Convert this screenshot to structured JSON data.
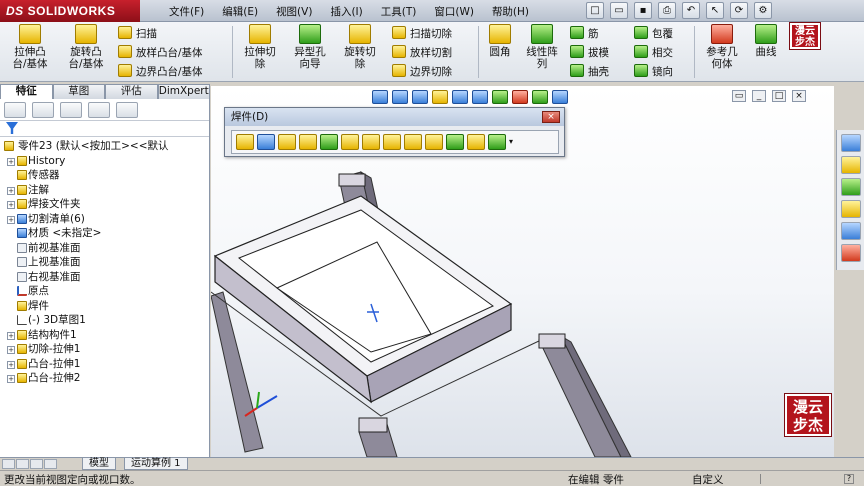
{
  "app": {
    "brand": "SOLIDWORKS",
    "brand_prefix": "DS"
  },
  "menu": [
    "文件(F)",
    "编辑(E)",
    "视图(V)",
    "插入(I)",
    "工具(T)",
    "窗口(W)",
    "帮助(H)"
  ],
  "commands": {
    "big": [
      {
        "label": "拉伸凸\n台/基体",
        "icon": "extrude-boss-icon"
      },
      {
        "label": "旋转凸\n台/基体",
        "icon": "revolve-boss-icon"
      },
      {
        "label": "拉伸切\n除",
        "icon": "extrude-cut-icon"
      },
      {
        "label": "异型孔\n向导",
        "icon": "hole-wizard-icon"
      },
      {
        "label": "旋转切\n除",
        "icon": "revolve-cut-icon"
      },
      {
        "label": "圆角",
        "icon": "fillet-icon"
      },
      {
        "label": "线性阵\n列",
        "icon": "linear-pattern-icon"
      },
      {
        "label": "参考几\n何体",
        "icon": "reference-geometry-icon"
      },
      {
        "label": "曲线",
        "icon": "curves-icon"
      }
    ],
    "small": [
      {
        "label": "扫描",
        "icon": "sweep-icon"
      },
      {
        "label": "放样凸台/基体",
        "icon": "loft-icon"
      },
      {
        "label": "边界凸台/基体",
        "icon": "boundary-boss-icon"
      },
      {
        "label": "扫描切除",
        "icon": "swept-cut-icon"
      },
      {
        "label": "放样切割",
        "icon": "lofted-cut-icon"
      },
      {
        "label": "边界切除",
        "icon": "boundary-cut-icon"
      },
      {
        "label": "筋",
        "icon": "rib-icon"
      },
      {
        "label": "拔模",
        "icon": "draft-icon"
      },
      {
        "label": "抽壳",
        "icon": "shell-icon"
      },
      {
        "label": "包覆",
        "icon": "wrap-icon"
      },
      {
        "label": "相交",
        "icon": "intersect-icon"
      },
      {
        "label": "镜向",
        "icon": "mirror-icon"
      }
    ]
  },
  "fm_tabs": [
    "特征",
    "草图",
    "评估",
    "DimXpert"
  ],
  "tree": {
    "root": "零件23  (默认<按加工><<默认",
    "items": [
      {
        "label": "History",
        "exp": "+"
      },
      {
        "label": "传感器",
        "exp": ""
      },
      {
        "label": "注解",
        "exp": "+"
      },
      {
        "label": "焊接文件夹",
        "exp": "+"
      },
      {
        "label": "切割清单(6)",
        "exp": "+"
      },
      {
        "label": "材质 <未指定>",
        "exp": ""
      },
      {
        "label": "前视基准面",
        "exp": ""
      },
      {
        "label": "上视基准面",
        "exp": ""
      },
      {
        "label": "右视基准面",
        "exp": ""
      },
      {
        "label": "原点",
        "exp": ""
      },
      {
        "label": "焊件",
        "exp": ""
      },
      {
        "label": "(-) 3D草图1",
        "exp": ""
      },
      {
        "label": "结构构件1",
        "exp": "+"
      },
      {
        "label": "切除-拉伸1",
        "exp": "+"
      },
      {
        "label": "凸台-拉伸1",
        "exp": "+"
      },
      {
        "label": "凸台-拉伸2",
        "exp": "+"
      }
    ]
  },
  "weldments": {
    "title": "焊件(D)",
    "close": "×",
    "icon_names": [
      "3d-sketch-icon",
      "structural-member-icon",
      "trim-extend-icon",
      "end-cap-icon",
      "gusset-icon",
      "fillet-bead-icon",
      "weldment-cut-list-icon",
      "weld-bead-icon",
      "extruded-boss-weld-icon",
      "extruded-cut-weld-icon",
      "hole-wizard-weld-icon",
      "chamfer-weld-icon",
      "reference-plane-icon"
    ]
  },
  "bottom_tabs": [
    "模型",
    "运动算例 1"
  ],
  "status": {
    "message": "更改当前视图定向或视口数。",
    "mode": "在编辑 零件",
    "units": "自定义"
  },
  "watermark": {
    "line1": "漫云",
    "line2": "步杰"
  },
  "colors": {
    "brand": "#c7202c",
    "frame": "#8e8a9a",
    "stamp": "#b3141c"
  }
}
